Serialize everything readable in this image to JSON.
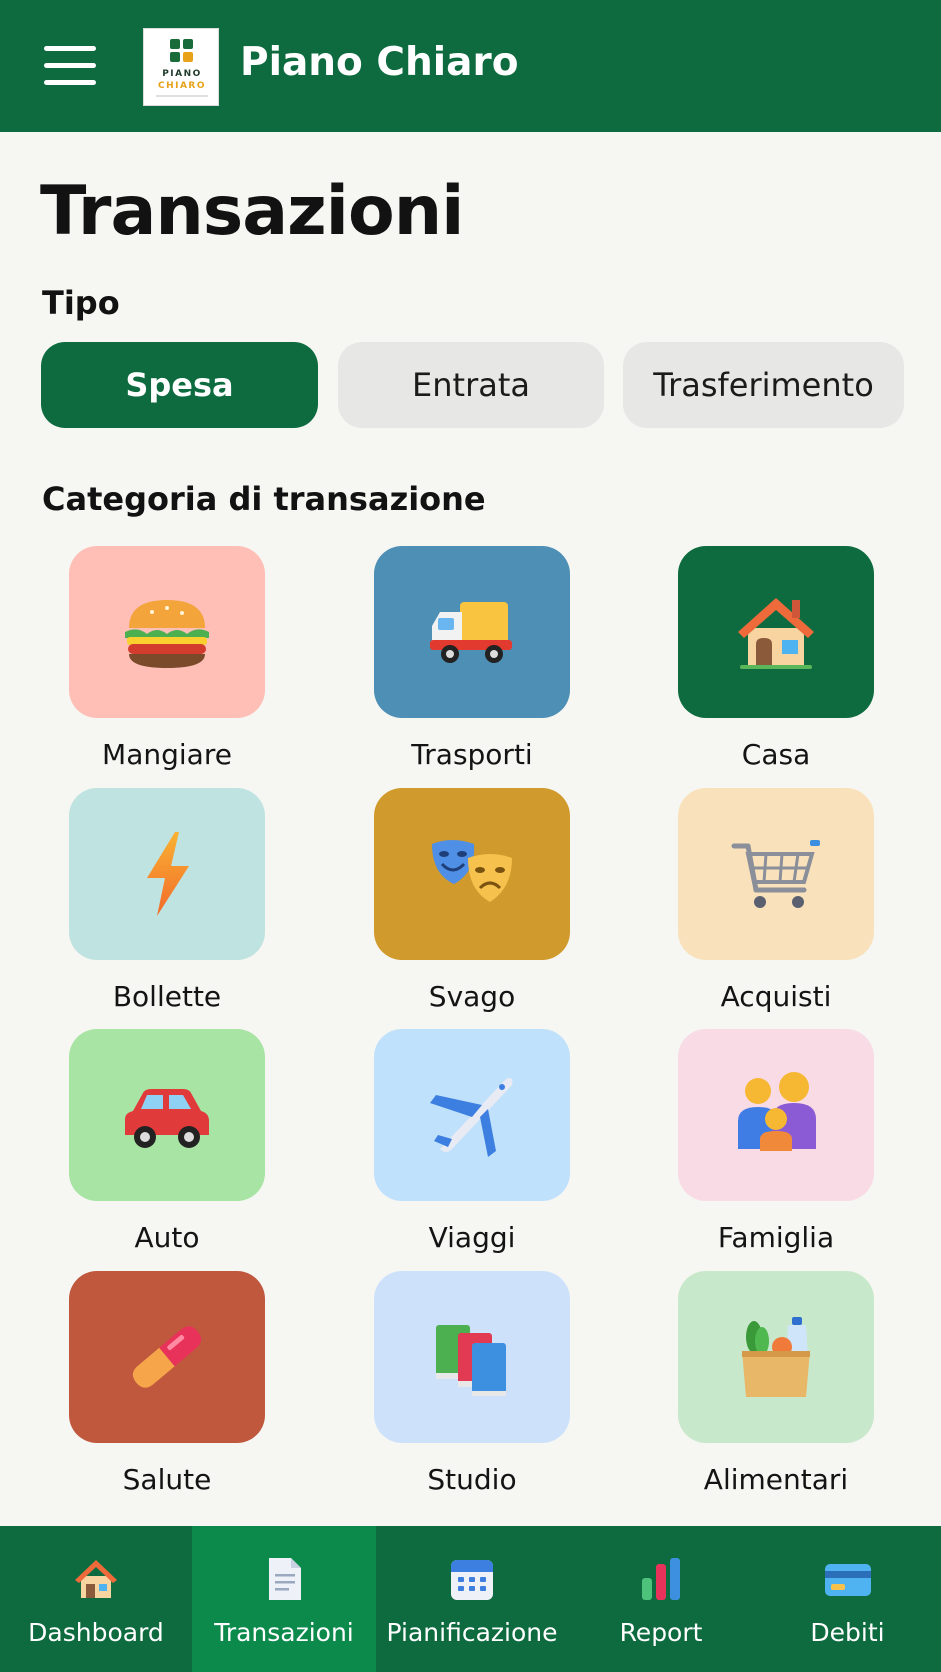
{
  "header": {
    "menu_icon": "hamburger-icon",
    "logo_line1": "PIANO",
    "logo_line2": "CHIARO",
    "app_title": "Piano Chiaro"
  },
  "page": {
    "title": "Transazioni",
    "type_label": "Tipo",
    "category_label": "Categoria di transazione"
  },
  "type_options": [
    {
      "label": "Spesa",
      "selected": true
    },
    {
      "label": "Entrata",
      "selected": false
    },
    {
      "label": "Trasferimento",
      "selected": false
    }
  ],
  "categories": [
    {
      "label": "Mangiare",
      "icon": "burger-icon",
      "color": "#ffbfb7"
    },
    {
      "label": "Trasporti",
      "icon": "truck-icon",
      "color": "#4e8fb5"
    },
    {
      "label": "Casa",
      "icon": "house-icon",
      "color": "#0d6b3f"
    },
    {
      "label": "Bollette",
      "icon": "lightning-icon",
      "color": "#bfe3e0"
    },
    {
      "label": "Svago",
      "icon": "theater-masks-icon",
      "color": "#d09a2c"
    },
    {
      "label": "Acquisti",
      "icon": "shopping-cart-icon",
      "color": "#f9e2bb"
    },
    {
      "label": "Auto",
      "icon": "car-icon",
      "color": "#a8e4a4"
    },
    {
      "label": "Viaggi",
      "icon": "airplane-icon",
      "color": "#bfe1fb"
    },
    {
      "label": "Famiglia",
      "icon": "family-icon",
      "color": "#f9dbe6"
    },
    {
      "label": "Salute",
      "icon": "pill-icon",
      "color": "#c0583e"
    },
    {
      "label": "Studio",
      "icon": "books-icon",
      "color": "#cde2fa"
    },
    {
      "label": "Alimentari",
      "icon": "grocery-bag-icon",
      "color": "#c8e8cb"
    }
  ],
  "bottom_nav": [
    {
      "label": "Dashboard",
      "icon": "house-icon",
      "active": false
    },
    {
      "label": "Transazioni",
      "icon": "document-icon",
      "active": true
    },
    {
      "label": "Pianificazione",
      "icon": "calendar-icon",
      "active": false
    },
    {
      "label": "Report",
      "icon": "bar-chart-icon",
      "active": false
    },
    {
      "label": "Debiti",
      "icon": "credit-card-icon",
      "active": false
    }
  ],
  "colors": {
    "brand_green": "#0d6b3f",
    "nav_active": "#0b8a4c",
    "background": "#f6f6f3",
    "inactive_button": "#e7e8e5"
  }
}
